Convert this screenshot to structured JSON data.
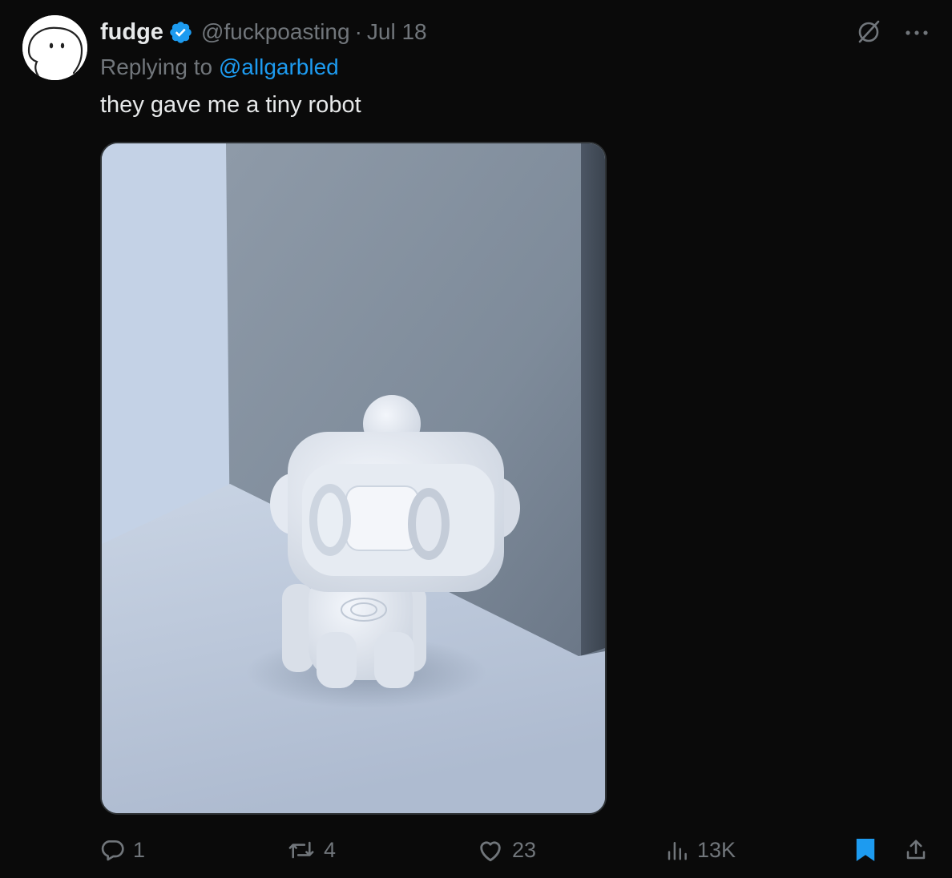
{
  "tweet": {
    "display_name": "fudge",
    "handle": "@fuckpoasting",
    "separator": "·",
    "date": "Jul 18",
    "replying_label": "Replying to",
    "reply_to_handle": "@allgarbled",
    "text": "they gave me a tiny robot"
  },
  "actions": {
    "replies": "1",
    "reposts": "4",
    "likes": "23",
    "views": "13K"
  },
  "colors": {
    "background": "#0a0a0a",
    "text_primary": "#e7e9ea",
    "text_secondary": "#71767b",
    "accent_blue": "#1d9bf0",
    "verified_blue": "#1d9bf0"
  },
  "icons": {
    "avatar": "blob-face-avatar",
    "verified": "verified-badge-icon",
    "grok": "grok-icon",
    "more": "more-icon",
    "reply": "reply-icon",
    "repost": "repost-icon",
    "like": "heart-icon",
    "views": "views-icon",
    "bookmark": "bookmark-icon",
    "share": "share-icon"
  }
}
